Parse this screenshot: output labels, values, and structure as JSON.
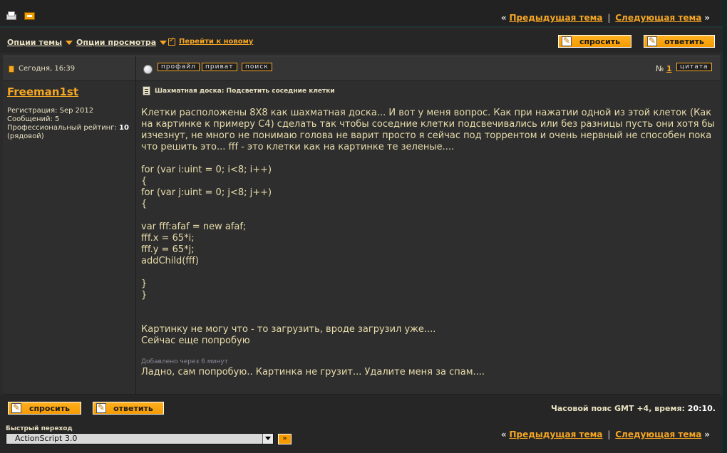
{
  "nav": {
    "prev_label": "Предыдущая тема",
    "next_label": "Следующая тема",
    "open_bracket": "«",
    "separator": "|",
    "close_bracket": "»"
  },
  "options": {
    "thread_options": "Опции темы",
    "view_options": "Опции просмотра",
    "go_to_new": "Перейти к новому"
  },
  "buttons": {
    "ask": "спросить",
    "reply": "ответить"
  },
  "post": {
    "date": "Сегодня, 16:39",
    "tags": [
      "профайл",
      "приват",
      "поиск"
    ],
    "number_prefix": "№",
    "number": "1",
    "quote": "цитата",
    "author": "Freeman1st",
    "reg": "Регистрация: Sep 2012",
    "messages": "Сообщений: 5",
    "rating_label": "Профессиональный рейтинг:",
    "rating_value": "10",
    "rank": "(рядовой)",
    "title": "Шахматная доска: Подсветить соседние клетки",
    "body": "Клетки расположены 8X8 как шахматная доска... И вот у меня вопрос. Как при нажатии одной из этой клеток (Как на картинке к примеру C4) сделать так чтобы соседние клетки подсвечивались или без разницы пусть они хотя бы изчезнут, не много не понимаю голова не варит просто я сейчас под торрентом и очень нервный не способен пока что решить это... fff - это клетки как на картинке те зеленые....\n\nfor (var i:uint = 0; i<8; i++)\n{\nfor (var j:uint = 0; j<8; j++)\n{\n\nvar fff:afaf = new afaf;\nfff.x = 65*i;\nfff.y = 65*j;\naddChild(fff)\n\n}\n}\n\n\nКартинку не могу что - то загрузить, вроде загрузил уже....\nСейчас еще попробую",
    "added_note": "Добавлено через 6 минут",
    "body2": "Ладно, сам попробую.. Картинка не грузит... Удалите меня за спам...."
  },
  "footer": {
    "tz_label": "Часовой пояс GMT +4, время:",
    "tz_time": "20:10.",
    "quick_jump_label": "Быстрый переход",
    "quick_jump_value": "ActionScript 3.0",
    "go_symbol": "»"
  },
  "colors": {
    "accent": "#f5a623",
    "button": "#f59a00",
    "page_bg": "#2b2b2b",
    "outer_bg": "#0d2a2a"
  }
}
